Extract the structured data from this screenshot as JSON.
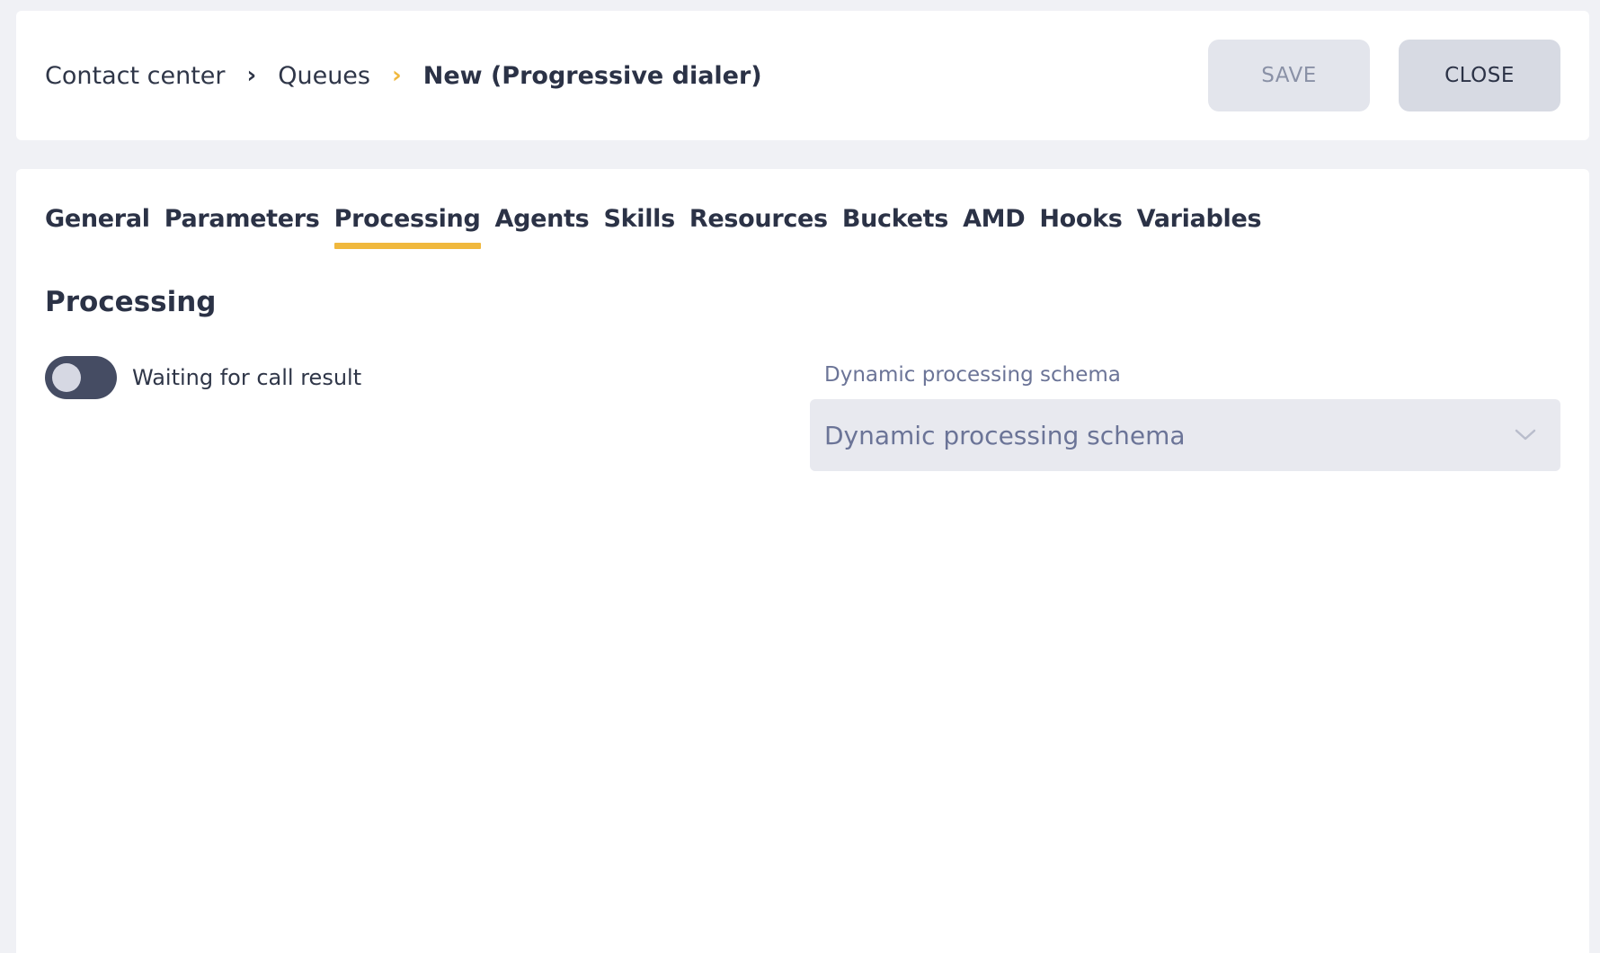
{
  "header": {
    "breadcrumb": [
      {
        "label": "Contact center"
      },
      {
        "label": "Queues"
      },
      {
        "label": "New (Progressive dialer)"
      }
    ],
    "save_label": "SAVE",
    "close_label": "CLOSE"
  },
  "tabs": [
    {
      "label": "General"
    },
    {
      "label": "Parameters"
    },
    {
      "label": "Processing",
      "active": true
    },
    {
      "label": "Agents"
    },
    {
      "label": "Skills"
    },
    {
      "label": "Resources"
    },
    {
      "label": "Buckets"
    },
    {
      "label": "AMD"
    },
    {
      "label": "Hooks"
    },
    {
      "label": "Variables"
    }
  ],
  "section": {
    "title": "Processing",
    "toggle": {
      "label": "Waiting for call result",
      "checked": false
    },
    "dynamic_schema": {
      "label": "Dynamic processing schema",
      "placeholder": "Dynamic processing schema",
      "value": ""
    }
  },
  "colors": {
    "accent": "#f0b83d",
    "toggle_track": "#454c63",
    "muted_text": "#6b7497"
  },
  "icons": {
    "breadcrumb_separator": "chevron-right-icon",
    "select_arrow": "chevron-down-icon"
  }
}
